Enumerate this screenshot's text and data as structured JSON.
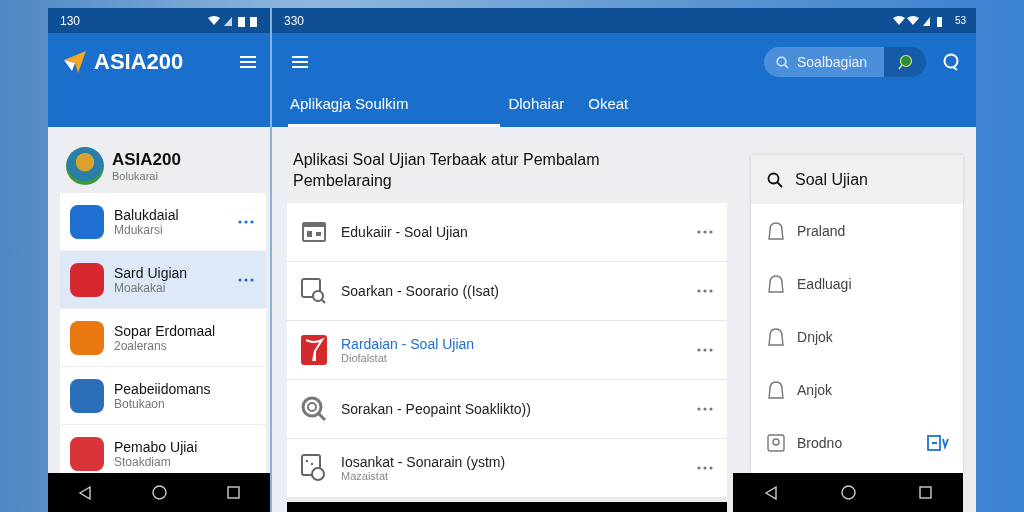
{
  "left_phone": {
    "status_time": "130",
    "app_title": "ASIA200",
    "profile": {
      "name": "ASIA200",
      "subtitle": "Bolukarai"
    },
    "items": [
      {
        "title": "Balukdaial",
        "subtitle": "Mdukarsi",
        "color": "#1f6fd0",
        "selected": false,
        "more": true
      },
      {
        "title": "Sard Uigian",
        "subtitle": "Moakakai",
        "color": "#d6282e",
        "selected": true,
        "more": true
      },
      {
        "title": "Sopar Erdomaal",
        "subtitle": "2oalerans",
        "color": "#e8780f",
        "selected": false,
        "more": false
      },
      {
        "title": "Peabeiidomans",
        "subtitle": "Botukaon",
        "color": "#2a6fb8",
        "selected": false,
        "more": false
      },
      {
        "title": "Pemabo Ujiai",
        "subtitle": "Stoakdiam",
        "color": "#d8343a",
        "selected": false,
        "more": false
      }
    ]
  },
  "right_phone": {
    "status_time": "330",
    "status_battery": "53",
    "search": {
      "value": "Soalbagian"
    },
    "tabs": [
      {
        "label": "Aplikagja Soulkim",
        "selected": true
      },
      {
        "label": "Dlohaiar",
        "selected": false
      },
      {
        "label": "Okeat",
        "selected": false
      }
    ],
    "heading": "Aplikasi Soal Ujian Terbaak atur Pembalam Pembelaraing",
    "rows": [
      {
        "kind": "card",
        "title": "Edukaiir - Soal Ujian",
        "highlighted": false
      },
      {
        "kind": "search-doc",
        "title": "Soarkan - Soorario ((Isat)",
        "highlighted": false
      },
      {
        "kind": "app",
        "title": "Rardaian - Soal Ujian",
        "subtitle": "Diofalstat",
        "highlighted": true
      },
      {
        "kind": "search",
        "title": "Sorakan - Peopaint Soaklikto))",
        "highlighted": false
      },
      {
        "kind": "doc",
        "title": "Iosankat - Sonarain (ystm)",
        "subtitle": "Mazaistat",
        "highlighted": false
      }
    ],
    "panel": {
      "title": "Soal Ujian",
      "items": [
        {
          "kind": "bell",
          "label": "Praland",
          "action": false
        },
        {
          "kind": "bell",
          "label": "Eadluagi",
          "action": false
        },
        {
          "kind": "bell",
          "label": "Dnjok",
          "action": false
        },
        {
          "kind": "bell",
          "label": "Anjok",
          "action": false
        },
        {
          "kind": "box",
          "label": "Brodno",
          "action": true
        }
      ]
    }
  }
}
